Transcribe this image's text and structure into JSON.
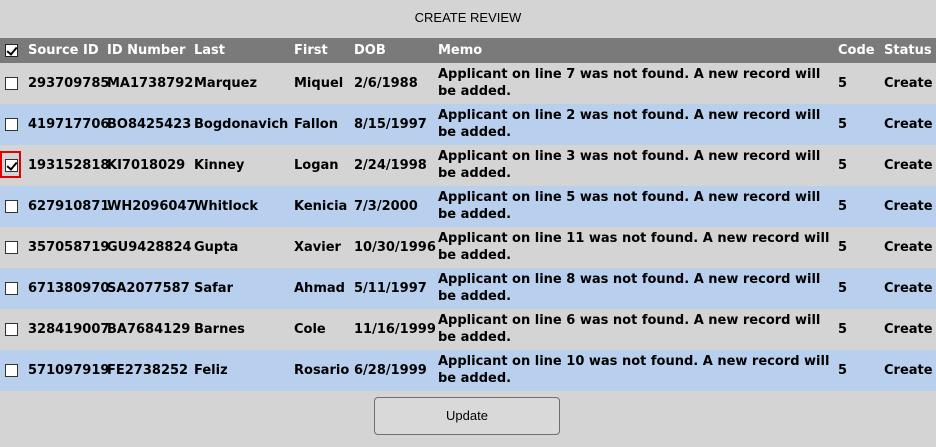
{
  "title": "CREATE REVIEW",
  "columns": {
    "source_id": "Source ID",
    "id_number": "ID Number",
    "last": "Last",
    "first": "First",
    "dob": "DOB",
    "memo": "Memo",
    "code": "Code",
    "status": "Status"
  },
  "header_checkbox_checked": true,
  "rows": [
    {
      "checked": false,
      "source_id": "293709785",
      "id_number": "MA1738792",
      "last": "Marquez",
      "first": "Miquel",
      "dob": "2/6/1988",
      "memo": "Applicant on line 7 was not found. A new record will be added.",
      "code": "5",
      "status": "Create"
    },
    {
      "checked": false,
      "source_id": "419717706",
      "id_number": "BO8425423",
      "last": "Bogdonavich",
      "first": "Fallon",
      "dob": "8/15/1997",
      "memo": "Applicant on line 2 was not found. A new record will be added.",
      "code": "5",
      "status": "Create"
    },
    {
      "checked": true,
      "source_id": "193152818",
      "id_number": "KI7018029",
      "last": "Kinney",
      "first": "Logan",
      "dob": "2/24/1998",
      "memo": "Applicant on line 3 was not found. A new record will be added.",
      "code": "5",
      "status": "Create"
    },
    {
      "checked": false,
      "source_id": "627910871",
      "id_number": "WH2096047",
      "last": "Whitlock",
      "first": "Kenicia",
      "dob": "7/3/2000",
      "memo": "Applicant on line 5 was not found. A new record will be added.",
      "code": "5",
      "status": "Create"
    },
    {
      "checked": false,
      "source_id": "357058719",
      "id_number": "GU9428824",
      "last": "Gupta",
      "first": "Xavier",
      "dob": "10/30/1996",
      "memo": "Applicant on line 11 was not found. A new record will be added.",
      "code": "5",
      "status": "Create"
    },
    {
      "checked": false,
      "source_id": "671380970",
      "id_number": "SA2077587",
      "last": "Safar",
      "first": "Ahmad",
      "dob": "5/11/1997",
      "memo": "Applicant on line 8 was not found. A new record will be added.",
      "code": "5",
      "status": "Create"
    },
    {
      "checked": false,
      "source_id": "328419007",
      "id_number": "BA7684129",
      "last": "Barnes",
      "first": "Cole",
      "dob": "11/16/1999",
      "memo": "Applicant on line 6 was not found. A new record will be added.",
      "code": "5",
      "status": "Create"
    },
    {
      "checked": false,
      "source_id": "571097919",
      "id_number": "FE2738252",
      "last": "Feliz",
      "first": "Rosario",
      "dob": "6/28/1999",
      "memo": "Applicant on line 10 was not found. A new record will be added.",
      "code": "5",
      "status": "Create"
    }
  ],
  "update_label": "Update"
}
